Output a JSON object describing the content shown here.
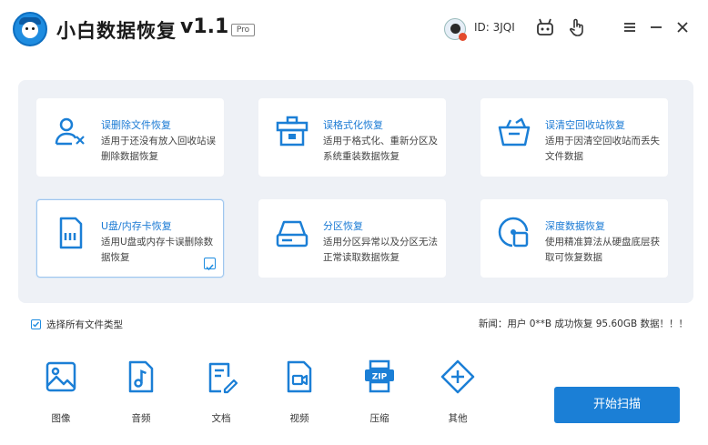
{
  "app": {
    "title": "小白数据恢复",
    "version": "v1.1",
    "badge": "Pro",
    "user_id": "ID: 3JQI"
  },
  "titlebar_icons": [
    "robot-icon",
    "pointer-hand-icon",
    "menu-icon",
    "minimize-icon",
    "close-icon"
  ],
  "cards": [
    {
      "name": "deleted-file-recovery",
      "icon": "user-delete-icon",
      "title": "误删除文件恢复",
      "desc": "适用于还没有放入回收站误删除数据恢复",
      "selected": false
    },
    {
      "name": "format-recovery",
      "icon": "format-icon",
      "title": "误格式化恢复",
      "desc": "适用于格式化、重新分区及系统重装数据恢复",
      "selected": false
    },
    {
      "name": "recycle-bin-recovery",
      "icon": "basket-icon",
      "title": "误清空回收站恢复",
      "desc": "适用于因清空回收站而丢失文件数据",
      "selected": false
    },
    {
      "name": "usb-card-recovery",
      "icon": "sd-card-icon",
      "title": "U盘/内存卡恢复",
      "desc": "适用U盘或内存卡误删除数据恢复",
      "selected": true
    },
    {
      "name": "partition-recovery",
      "icon": "drive-icon",
      "title": "分区恢复",
      "desc": "适用分区异常以及分区无法正常读取数据恢复",
      "selected": false
    },
    {
      "name": "deep-recovery",
      "icon": "deep-scan-icon",
      "title": "深度数据恢复",
      "desc": "使用精准算法从硬盘底层获取可恢复数据",
      "selected": false
    }
  ],
  "select_all": {
    "label": "选择所有文件类型",
    "checked": true
  },
  "news": "新闻：用户 0**B 成功恢复 95.60GB 数据！！！",
  "file_types": [
    {
      "name": "image",
      "icon": "image-icon",
      "label": "图像"
    },
    {
      "name": "audio",
      "icon": "music-icon",
      "label": "音频"
    },
    {
      "name": "document",
      "icon": "document-icon",
      "label": "文档"
    },
    {
      "name": "video",
      "icon": "video-icon",
      "label": "视频"
    },
    {
      "name": "archive",
      "icon": "zip-icon",
      "label": "压缩"
    },
    {
      "name": "other",
      "icon": "plus-icon",
      "label": "其他"
    }
  ],
  "scan_button": "开始扫描",
  "colors": {
    "accent": "#1b7fd6",
    "panel": "#eef1f6"
  }
}
